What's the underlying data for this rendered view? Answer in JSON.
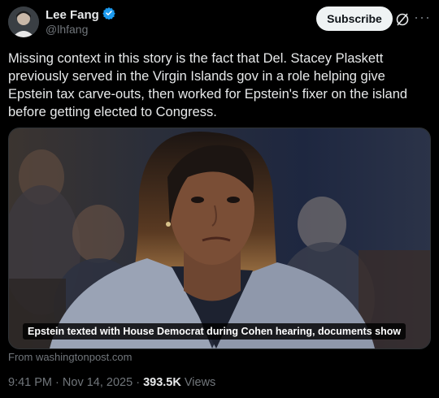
{
  "author": {
    "name": "Lee Fang",
    "handle": "@lhfang",
    "verified": true,
    "verified_color": "#1d9bf0"
  },
  "actions": {
    "subscribe_label": "Subscribe",
    "grok_icon": "grok-icon",
    "more_icon": "more-icon"
  },
  "tweet": {
    "text": "Missing context in this story is the fact that Del. Stacey Plaskett previously served in the Virgin Islands gov in a role helping give Epstein tax carve-outs, then worked for Epstein's fixer on the island before getting elected to Congress."
  },
  "card": {
    "caption": "Epstein texted with House Democrat during Cohen hearing, documents show",
    "source": "From washingtonpost.com"
  },
  "meta": {
    "time": "9:41 PM",
    "sep1": "·",
    "date": "Nov 14, 2025",
    "sep2": "·",
    "views_count": "393.5K",
    "views_label": "Views"
  }
}
